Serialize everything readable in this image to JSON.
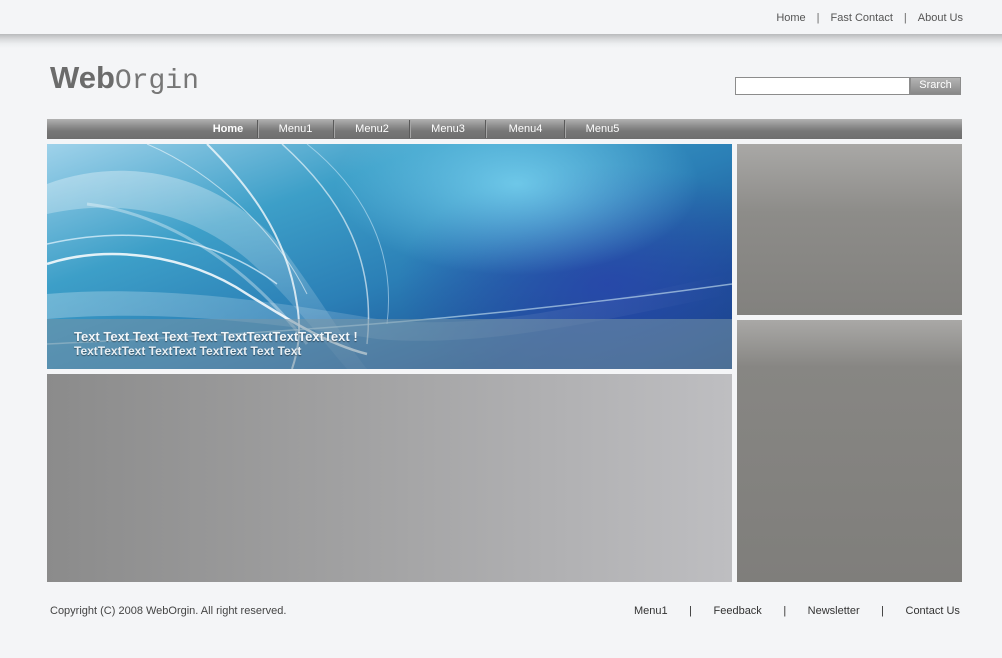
{
  "top_links": {
    "home": "Home",
    "fast_contact": "Fast Contact",
    "about_us": "About Us",
    "separator": "|"
  },
  "logo": {
    "part1": "Web",
    "part2": "Orgin"
  },
  "search": {
    "value": "",
    "button_label": "Srarch"
  },
  "nav": {
    "items": [
      {
        "label": "Home",
        "active": true
      },
      {
        "label": "Menu1"
      },
      {
        "label": "Menu2"
      },
      {
        "label": "Menu3"
      },
      {
        "label": "Menu4"
      },
      {
        "label": "Menu5"
      }
    ]
  },
  "hero": {
    "line1": "Text Text Text Text Text TextTextTextTextText !",
    "line2": "TextTextText TextText TextText Text Text"
  },
  "footer": {
    "copyright": "Copyright (C) 2008 WebOrgin. All right reserved.",
    "links": [
      "Menu1",
      "Feedback",
      "Newsletter",
      "Contact Us"
    ],
    "separator": "|"
  },
  "colors": {
    "background": "#f4f5f7",
    "nav_bar": "#777777",
    "side_panel": "#82817e",
    "hero_blue": "#2b7fb6"
  }
}
